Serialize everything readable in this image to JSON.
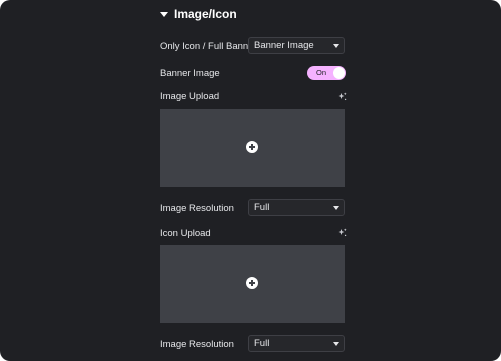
{
  "section": {
    "title": "Image/Icon"
  },
  "fields": {
    "only_icon": {
      "label": "Only Icon / Full Banner",
      "value": "Banner Image"
    },
    "banner_image": {
      "label": "Banner Image",
      "toggle_text": "On"
    },
    "image_upload": {
      "label": "Image Upload"
    },
    "image_resolution_1": {
      "label": "Image Resolution",
      "value": "Full"
    },
    "icon_upload": {
      "label": "Icon Upload"
    },
    "image_resolution_2": {
      "label": "Image Resolution",
      "value": "Full"
    }
  },
  "icons": {
    "section_caret": "caret-down-icon",
    "ai": "sparkle-ai-icon",
    "upload": "plus-circle-icon",
    "select": "chevron-down-icon"
  },
  "colors": {
    "panel_bg": "#1f2024",
    "upload_area": "#3f4147",
    "toggle_on": "#f5b2ff",
    "text": "#e6e7ea"
  }
}
